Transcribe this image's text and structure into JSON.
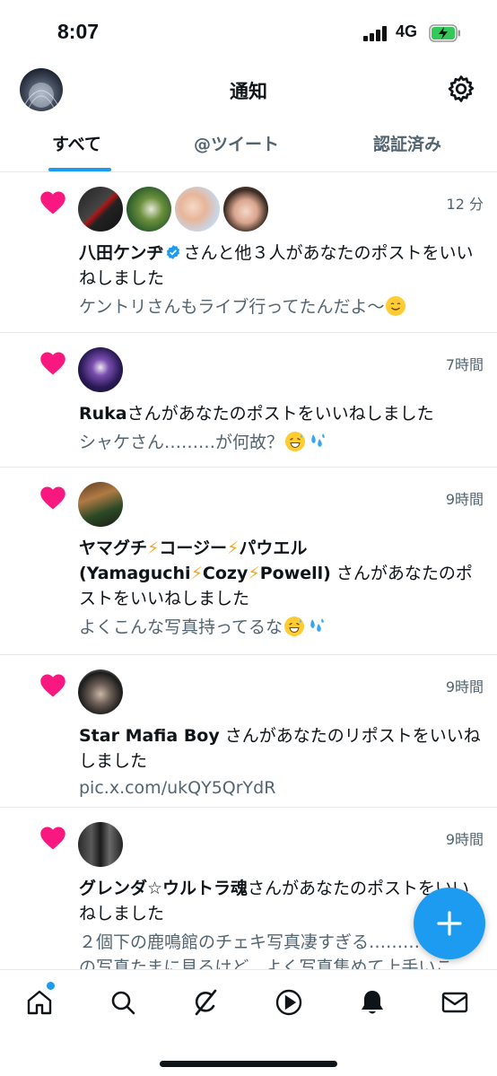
{
  "status_bar": {
    "time": "8:07",
    "network": "4G"
  },
  "header": {
    "title": "通知"
  },
  "tabs": [
    {
      "label": "すべて"
    },
    {
      "label": "@ツイート"
    },
    {
      "label": "認証済み"
    }
  ],
  "notifications": [
    {
      "time": "12 分",
      "user": "八田ケンヂ",
      "action": "さんと他３人があなたのポストをいいねしました",
      "preview": "ケントリさんもライブ行ってたんだよ〜"
    },
    {
      "time": "7時間",
      "user": "Ruka",
      "action": "さんがあなたのポストをいいねしました",
      "preview": "シャケさん………が何故？"
    },
    {
      "time": "9時間",
      "user_parts": [
        "ヤマグチ",
        "コージー",
        "パウエル",
        "(Yamaguchi",
        "Cozy",
        "Powell)"
      ],
      "action": " さんがあなたのポストをいいねしました",
      "preview": "よくこんな写真持ってるな"
    },
    {
      "time": "9時間",
      "user": "Star Mafia Boy",
      "action": " さんがあなたのリポストをいいねしました",
      "preview": "pic.x.com/ukQY5QrYdR"
    },
    {
      "time": "9時間",
      "user": "グレンダ☆ウルトラ魂",
      "action": "さんがあなたのポストをいいねしました",
      "preview": "２個下の鹿鳴館のチェキ写真凄すぎる………",
      "preview2": "の写真たまに見るけど、よく写真集めて上手いこ"
    }
  ],
  "colors": {
    "accent": "#1d9bf0",
    "heart": "#f91880",
    "secondary_text": "#536471"
  },
  "icons": [
    "home-icon",
    "search-icon",
    "grok-icon",
    "play-icon",
    "bell-icon",
    "mail-icon",
    "gear-icon",
    "heart-icon",
    "verified-icon",
    "compose-plus-icon"
  ]
}
